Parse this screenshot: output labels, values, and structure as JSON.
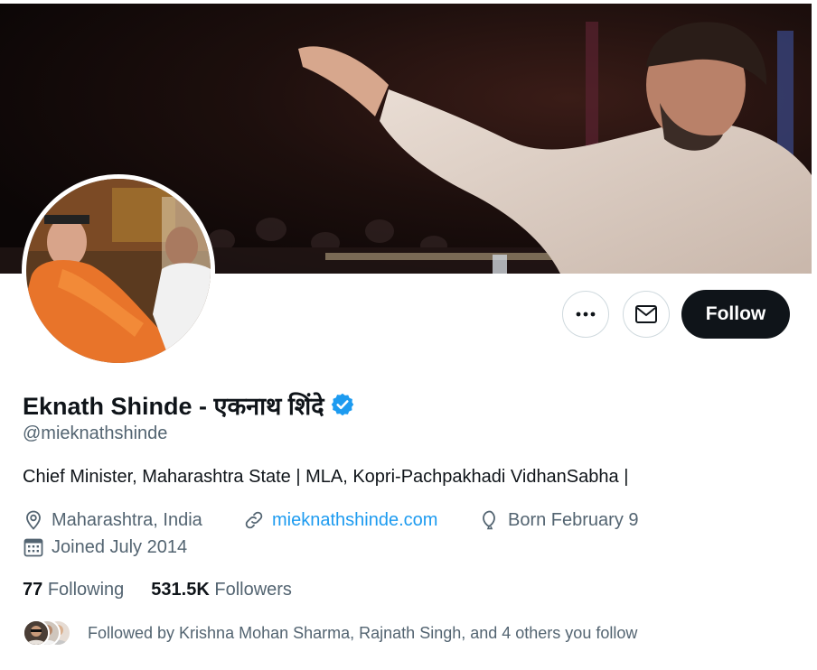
{
  "profile": {
    "display_name": "Eknath Shinde - एकनाथ शिंदे",
    "handle": "@mieknathshinde",
    "bio": "Chief Minister, Maharashtra State | MLA, Kopri-Pachpakhadi VidhanSabha |",
    "location": "Maharashtra, India",
    "website": "mieknathshinde.com",
    "birthday": "Born February 9",
    "joined": "Joined July 2014",
    "verified_color": "#1d9bf0"
  },
  "actions": {
    "follow_label": "Follow",
    "more_icon": "more-icon",
    "message_icon": "envelope-icon"
  },
  "stats": {
    "following_count": "77",
    "following_label": "Following",
    "followers_count": "531.5K",
    "followers_label": "Followers"
  },
  "followed_by": {
    "text": "Followed by Krishna Mohan Sharma, Rajnath Singh, and 4 others you follow"
  },
  "icons": {
    "location": "location-pin-icon",
    "link": "link-icon",
    "birthday": "balloon-icon",
    "joined": "calendar-icon",
    "verified": "verified-badge-icon"
  },
  "colors": {
    "accent": "#1d9bf0",
    "primary_text": "#0f1419",
    "secondary_text": "#536471",
    "follow_button": "#0f1419"
  }
}
